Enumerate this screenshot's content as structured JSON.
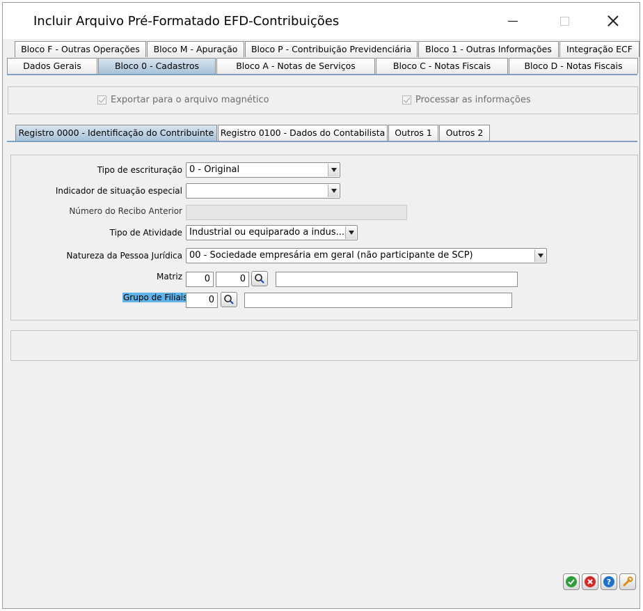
{
  "window": {
    "title": "Incluir Arquivo Pré-Formatado EFD-Contribuições"
  },
  "tabs_row1": [
    "Bloco F - Outras Operações",
    "Bloco M - Apuração",
    "Bloco P - Contribuição Previdenciária",
    "Bloco 1 - Outras Informações",
    "Integração ECF"
  ],
  "tabs_row2": [
    "Dados Gerais",
    "Bloco 0 - Cadastros",
    "Bloco A - Notas de Serviços",
    "Bloco C - Notas Fiscais",
    "Bloco D - Notas Fiscais"
  ],
  "options": {
    "exportar_label": "Exportar para o arquivo magnético",
    "processar_label": "Processar as informações"
  },
  "subtabs": [
    "Registro 0000 - Identificação do Contribuinte",
    "Registro 0100 - Dados do Contabilista",
    "Outros 1",
    "Outros 2"
  ],
  "form": {
    "tipo_escrituracao_label": "Tipo de escrituração",
    "tipo_escrituracao_value": "0 - Original",
    "indicador_label": "Indicador de situação especial",
    "indicador_value": "",
    "recibo_label": "Número do Recibo Anterior",
    "recibo_value": "",
    "tipo_atividade_label": "Tipo de Atividade",
    "tipo_atividade_value": "Industrial ou equiparado a indus...",
    "natureza_label": "Natureza da Pessoa Jurídica",
    "natureza_value": "00 - Sociedade empresária em geral (não participante de SCP)",
    "matriz_label": "Matriz",
    "matriz_value1": "0",
    "matriz_value2": "0",
    "matriz_desc": "",
    "grupo_label": "Grupo de Filiais",
    "grupo_value": "0",
    "grupo_desc": ""
  },
  "actions": {
    "ok_icon": "check-icon",
    "cancel_icon": "cancel-icon",
    "help_icon": "help-icon",
    "tools_icon": "wrench-icon",
    "colors": {
      "ok": "#2e9d3a",
      "cancel": "#d12b2b",
      "help": "#1e73c8",
      "tools": "#e08a16"
    }
  }
}
